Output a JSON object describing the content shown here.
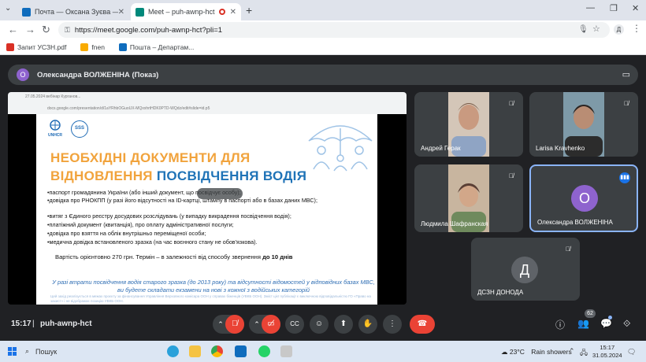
{
  "browser": {
    "tabs": [
      {
        "label": "Почта — Оксана Зуєва — Outl",
        "icon_color": "#0f6cbd"
      },
      {
        "label": "Meet – puh-awnp-hct",
        "icon_color": "#00897b"
      }
    ],
    "url": "https://meet.google.com/puh-awnp-hct?pli=1",
    "profile_initial": "Д",
    "bookmarks": [
      {
        "label": "Запит УСЗН.pdf",
        "icon_color": "#d93025"
      },
      {
        "label": "fnen",
        "icon_color": "#f9ab00"
      },
      {
        "label": "Пошта – Департам...",
        "icon_color": "#0f6cbd"
      }
    ]
  },
  "meet": {
    "presenter_initial": "О",
    "presenter_title": "Олександра ВОЛЖЕНІНА (Показ)",
    "slide": {
      "browser_tab_text": "27.05.2024 вебінар Курганов...",
      "browser_url_text": "docs.google.com/presentation/d/1aYRhbOGuoUX-MQxxhrtHDK0PTD-WQdz/edit#slide=id.p5",
      "logo_unhcr": "UNHCR",
      "logo_sss": "SSS",
      "title_line1": "НЕОБХІДНІ ДОКУМЕНТИ ДЛЯ",
      "title_line2_orange": "ВІДНОВЛЕННЯ ",
      "title_line2_blue": "ПОСВІДЧЕННЯ ВОДІЯ",
      "bullets": [
        "•паспорт громадянина України (або інший документ, що посвідчує особу);",
        "•довідка про РНОКПП (у разі його відсутності на ID-картці, штампу в паспорті або в базах даних МВС);",
        "•витяг з Єдиного реєстру досудових розслідувань (у випадку викрадення посвідчення водія);",
        "•платіжний документ (квитанція), про оплату адміністративної послуги;",
        "•довідка про взяття на облік внутрішньо переміщеної особи;",
        "•медична довідка встановленого зразка (на час воєнного стану не обов'язкова)."
      ],
      "cost_text": "Вартість орієнтовно 270 грн. Термін – в залежності від способу звернення ",
      "cost_bold": "до 10 днів",
      "note": "У разі втрати посвідчення водія старого зразка (до 2013 року) та відсутності відомостей у відповідних базах МВС, ви будете складати екзамени на нові з кожної з водійських категорій",
      "small_print": "Цей захід реалізується в межах проєкту за фінансування Управління Верховного комісара ООН у справах біженців (УВКБ ООН). Зміст цієї публікації є виключною відповідальністю ГО «Право на захист» і не відображає позицію УВКБ ООН."
    },
    "participants": [
      {
        "name": "Андрей Герак",
        "muted": true,
        "type": "video"
      },
      {
        "name": "Larisa Kravhenko",
        "muted": true,
        "type": "video"
      },
      {
        "name": "Людмила Шафранская",
        "muted": true,
        "type": "video"
      },
      {
        "name": "Олександра ВОЛЖЕНІНА",
        "initial": "О",
        "avatar_color": "#8e63ce",
        "speaking": true,
        "type": "avatar"
      },
      {
        "name": "ДСЗН ДОНОДА",
        "initial": "Д",
        "avatar_color": "#5f6368",
        "muted": true,
        "type": "avatar"
      }
    ],
    "controls": {
      "time": "15:17",
      "separator": "|",
      "meeting_code": "puh-awnp-hct",
      "people_count": "62"
    }
  },
  "taskbar": {
    "search_placeholder": "Пошук",
    "weather_temp": "23°C",
    "weather_text": "Rain showers",
    "time": "15:17",
    "date": "31.05.2024"
  },
  "colors": {
    "meet_bg": "#202124",
    "tile_bg": "#3c4043",
    "red": "#ea4335",
    "slide_orange": "#f1a33c",
    "slide_blue": "#1f73b7"
  }
}
